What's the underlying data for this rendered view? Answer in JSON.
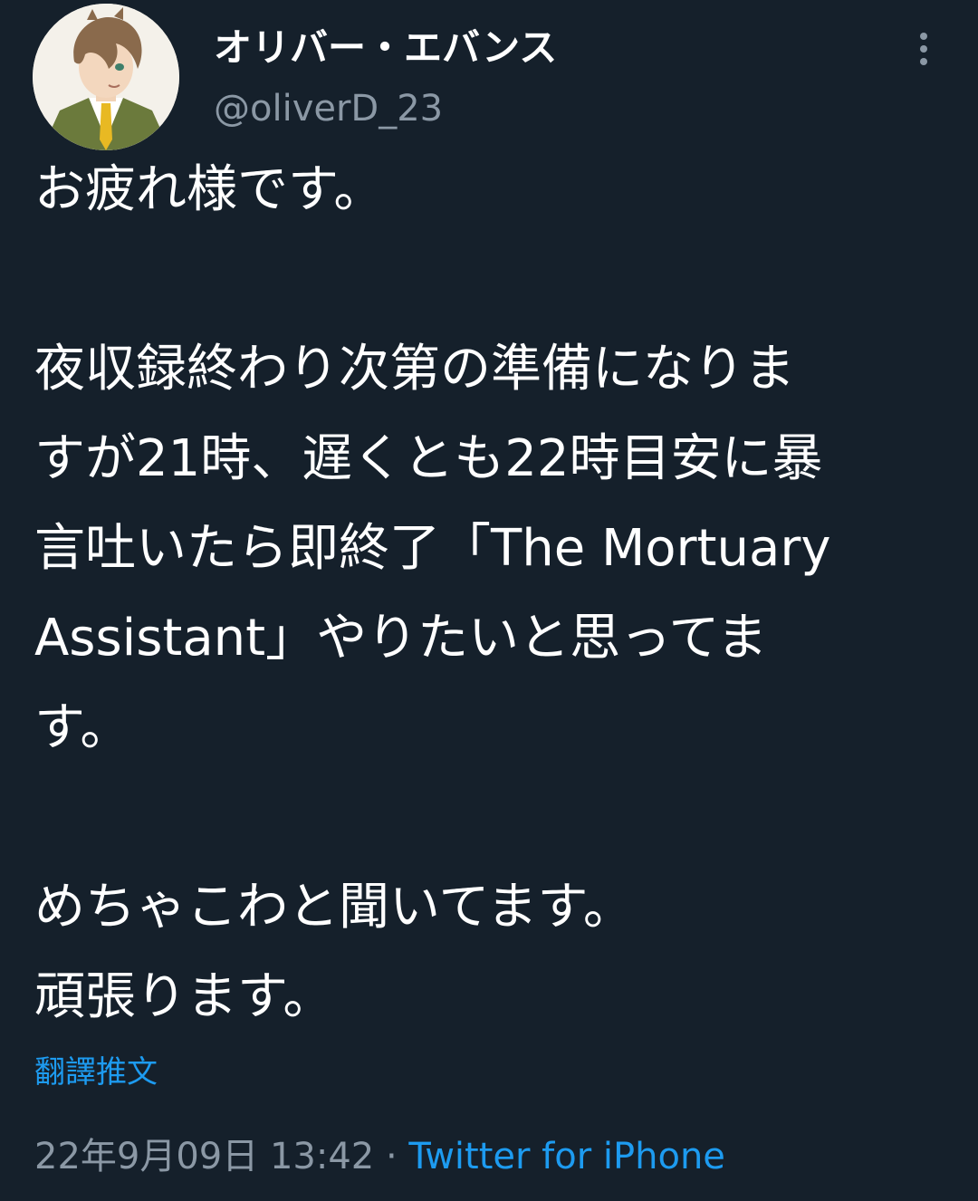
{
  "author": {
    "display_name": "オリバー・エバンス",
    "handle": "@oliverD_23",
    "avatar_icon": "anime-character-avatar"
  },
  "more_icon": "more-vertical-icon",
  "tweet": {
    "paragraph1": "お疲れ様です。",
    "paragraph2_lines": [
      "夜収録終わり次第の準備になりま",
      "すが21時、遅くとも22時目安に暴",
      "言吐いたら即終了「The Mortuary",
      "Assistant」やりたいと思ってま",
      "す。"
    ],
    "paragraph3_lines": [
      "めちゃこわと聞いてます。",
      "頑張ります。"
    ]
  },
  "translate_label": "翻譯推文",
  "meta": {
    "timestamp": "22年9月09日 13:42",
    "separator": " · ",
    "source": "Twitter for iPhone"
  },
  "colors": {
    "background": "#15202b",
    "text": "#ffffff",
    "secondary": "#8b98a5",
    "accent": "#1d9bf0"
  }
}
